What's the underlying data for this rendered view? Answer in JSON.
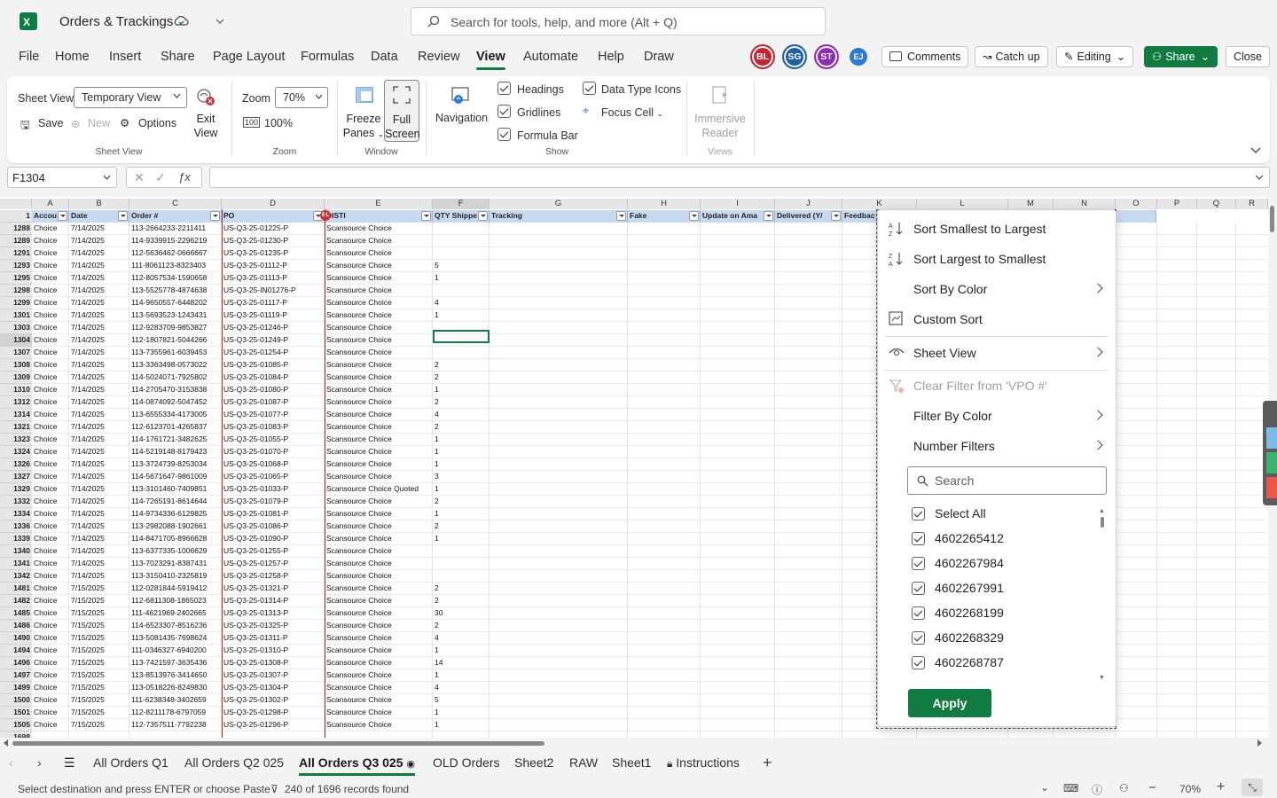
{
  "titlebar": {
    "app_icon": "excel-icon",
    "doc_title": "Orders & Trackings",
    "search_placeholder": "Search for tools, help, and more (Alt + Q)"
  },
  "menu": [
    "File",
    "Home",
    "Insert",
    "Share",
    "Page Layout",
    "Formulas",
    "Data",
    "Review",
    "View",
    "Automate",
    "Help",
    "Draw"
  ],
  "menu_active": "View",
  "collaborators": [
    {
      "initials": "BL",
      "color": "#c4262e"
    },
    {
      "initials": "SG",
      "color": "#1f5fa8"
    },
    {
      "initials": "ST",
      "color": "#8e2db4"
    },
    {
      "initials": "EJ",
      "color": "#2b7cd3"
    }
  ],
  "top_buttons": {
    "comments": "Comments",
    "catchup": "Catch up",
    "editing": "Editing",
    "share": "Share",
    "close": "Close"
  },
  "ribbon": {
    "sheet_view_label": "Sheet View",
    "sheet_view_value": "Temporary View",
    "exit_view": [
      "Exit",
      "View"
    ],
    "save": "Save",
    "new": "New",
    "options": "Options",
    "group_sheet_view": "Sheet View",
    "zoom_label": "Zoom",
    "zoom_value": "70%",
    "zoom_100": "100%",
    "group_zoom": "Zoom",
    "freeze": [
      "Freeze",
      "Panes"
    ],
    "full_screen": [
      "Full",
      "Screen"
    ],
    "group_window": "Window",
    "navigation": "Navigation",
    "headings": "Headings",
    "gridlines": "Gridlines",
    "formula_bar": "Formula Bar",
    "data_type_icons": "Data Type Icons",
    "focus_cell": "Focus Cell",
    "group_show": "Show",
    "immersive_reader": [
      "Immersive",
      "Reader"
    ],
    "group_views": "Views"
  },
  "formula_bar": {
    "name_box": "F1304",
    "content": ""
  },
  "grid": {
    "corner_row": "1",
    "column_letters": [
      "A",
      "B",
      "C",
      "D",
      "E",
      "F",
      "G",
      "H",
      "I",
      "J",
      "K",
      "L",
      "M",
      "N",
      "O",
      "P",
      "Q",
      "R"
    ],
    "headers": [
      "Accou",
      "Date",
      "Order #",
      "PO",
      "DISTI",
      "QTY Shippe",
      "Tracking",
      "Fake",
      "Update on Ama",
      "Delivered (Y/",
      "Feedbac"
    ],
    "rows": [
      [
        "1288",
        "Choice",
        "7/14/2025",
        "113-2664233-2211411",
        "US-Q3-25-01225-P",
        "Scansource Choice",
        ""
      ],
      [
        "1289",
        "Choice",
        "7/14/2025",
        "114-9339915-2296219",
        "US-Q3-25-01230-P",
        "Scansource Choice",
        ""
      ],
      [
        "1291",
        "Choice",
        "7/14/2025",
        "112-5636462-0666667",
        "US-Q3-25-01235-P",
        "Scansource Choice",
        ""
      ],
      [
        "1293",
        "Choice",
        "7/14/2025",
        "111-8061123-8323403",
        "US-Q3-25-01112-P",
        "Scansource Choice",
        "5"
      ],
      [
        "1295",
        "Choice",
        "7/14/2025",
        "112-8057534-1590658",
        "US-Q3-25-01113-P",
        "Scansource Choice",
        "1"
      ],
      [
        "1298",
        "Choice",
        "7/14/2025",
        "113-5525778-4874638",
        "US-Q3-25-IN01276-P",
        "Scansource Choice",
        ""
      ],
      [
        "1299",
        "Choice",
        "7/14/2025",
        "114-9650557-6448202",
        "US-Q3-25-01117-P",
        "Scansource Choice",
        "4"
      ],
      [
        "1301",
        "Choice",
        "7/14/2025",
        "113-5693523-1243431",
        "US-Q3-25-01119-P",
        "Scansource Choice",
        "1"
      ],
      [
        "1303",
        "Choice",
        "7/14/2025",
        "112-9283709-9853827",
        "US-Q3-25-01246-P",
        "Scansource Choice",
        ""
      ],
      [
        "1304",
        "Choice",
        "7/14/2025",
        "112-1807821-5044266",
        "US-Q3-25-01249-P",
        "Scansource Choice",
        ""
      ],
      [
        "1307",
        "Choice",
        "7/14/2025",
        "113-7355961-6039453",
        "US-Q3-25-01254-P",
        "Scansource Choice",
        ""
      ],
      [
        "1308",
        "Choice",
        "7/14/2025",
        "113-3363498-0573022",
        "US-Q3-25-01085-P",
        "Scansource Choice",
        "2"
      ],
      [
        "1309",
        "Choice",
        "7/14/2025",
        "114-5024071-7925802",
        "US-Q3-25-01084-P",
        "Scansource Choice",
        "2"
      ],
      [
        "1310",
        "Choice",
        "7/14/2025",
        "114-2705470-3153838",
        "US-Q3-25-01080-P",
        "Scansource Choice",
        "1"
      ],
      [
        "1312",
        "Choice",
        "7/14/2025",
        "114-0874092-5047452",
        "US-Q3-25-01087-P",
        "Scansource Choice",
        "2"
      ],
      [
        "1314",
        "Choice",
        "7/14/2025",
        "113-6555334-4173005",
        "US-Q3-25-01077-P",
        "Scansource Choice",
        "4"
      ],
      [
        "1321",
        "Choice",
        "7/14/2025",
        "112-6123701-4265837",
        "US-Q3-25-01083-P",
        "Scansource Choice",
        "2"
      ],
      [
        "1323",
        "Choice",
        "7/14/2025",
        "114-1761721-3482625",
        "US-Q3-25-01055-P",
        "Scansource Choice",
        "1"
      ],
      [
        "1324",
        "Choice",
        "7/14/2025",
        "114-5219148-8179423",
        "US-Q3-25-01070-P",
        "Scansource Choice",
        "1"
      ],
      [
        "1326",
        "Choice",
        "7/14/2025",
        "113-3724739-8253034",
        "US-Q3-25-01068-P",
        "Scansource Choice",
        "1"
      ],
      [
        "1327",
        "Choice",
        "7/14/2025",
        "114-5671647-9861009",
        "US-Q3-25-01065-P",
        "Scansource Choice",
        "3"
      ],
      [
        "1329",
        "Choice",
        "7/14/2025",
        "113-3101460-7409851",
        "US-Q3-25-01033-P",
        "Scansource Choice Quoted",
        "1"
      ],
      [
        "1332",
        "Choice",
        "7/14/2025",
        "114-7265191-8614644",
        "US-Q3-25-01079-P",
        "Scansource Choice",
        "2"
      ],
      [
        "1334",
        "Choice",
        "7/14/2025",
        "114-9734336-6129825",
        "US-Q3-25-01081-P",
        "Scansource Choice",
        "1"
      ],
      [
        "1336",
        "Choice",
        "7/14/2025",
        "113-2982088-1902661",
        "US-Q3-25-01086-P",
        "Scansource Choice",
        "2"
      ],
      [
        "1339",
        "Choice",
        "7/14/2025",
        "114-8471705-8966628",
        "US-Q3-25-01090-P",
        "Scansource Choice",
        "1"
      ],
      [
        "1340",
        "Choice",
        "7/14/2025",
        "113-6377335-1006629",
        "US-Q3-25-01255-P",
        "Scansource Choice",
        ""
      ],
      [
        "1341",
        "Choice",
        "7/14/2025",
        "113-7023291-8387431",
        "US-Q3-25-01257-P",
        "Scansource Choice",
        ""
      ],
      [
        "1342",
        "Choice",
        "7/14/2025",
        "113-3150410-2325819",
        "US-Q3-25-01258-P",
        "Scansource Choice",
        ""
      ],
      [
        "1481",
        "Choice",
        "7/15/2025",
        "112-0281844-5919412",
        "US-Q3-25-01321-P",
        "Scansource Choice",
        "2"
      ],
      [
        "1482",
        "Choice",
        "7/15/2025",
        "112-6811308-1865023",
        "US-Q3-25-01314-P",
        "Scansource Choice",
        "2"
      ],
      [
        "1485",
        "Choice",
        "7/15/2025",
        "111-4621969-2402665",
        "US-Q3-25-01313-P",
        "Scansource Choice",
        "30"
      ],
      [
        "1486",
        "Choice",
        "7/15/2025",
        "114-6523307-8516236",
        "US-Q3-25-01325-P",
        "Scansource Choice",
        "2"
      ],
      [
        "1490",
        "Choice",
        "7/15/2025",
        "113-5081435-7698624",
        "US-Q3-25-01311-P",
        "Scansource Choice",
        "4"
      ],
      [
        "1494",
        "Choice",
        "7/15/2025",
        "111-0346327-6940200",
        "US-Q3-25-01310-P",
        "Scansource Choice",
        "1"
      ],
      [
        "1496",
        "Choice",
        "7/15/2025",
        "113-7421597-3635436",
        "US-Q3-25-01308-P",
        "Scansource Choice",
        "14"
      ],
      [
        "1497",
        "Choice",
        "7/15/2025",
        "113-8513976-3414650",
        "US-Q3-25-01307-P",
        "Scansource Choice",
        "1"
      ],
      [
        "1499",
        "Choice",
        "7/15/2025",
        "113-0518226-8249830",
        "US-Q3-25-01304-P",
        "Scansource Choice",
        "4"
      ],
      [
        "1500",
        "Choice",
        "7/15/2025",
        "111-6238348-3402659",
        "US-Q3-25-01302-P",
        "Scansource Choice",
        "5"
      ],
      [
        "1501",
        "Choice",
        "7/15/2025",
        "112-8211178-6797059",
        "US-Q3-25-01298-P",
        "Scansource Choice",
        "1"
      ],
      [
        "1505",
        "Choice",
        "7/15/2025",
        "112-7357511-7792238",
        "US-Q3-25-01296-P",
        "Scansource Choice",
        "1"
      ],
      [
        "1698",
        "",
        "",
        "",
        "",
        "",
        ""
      ]
    ],
    "filter_badge": "BL"
  },
  "dropdown": {
    "sort_asc": "Sort Smallest to Largest",
    "sort_desc": "Sort Largest to Smallest",
    "sort_color": "Sort By Color",
    "custom_sort": "Custom Sort",
    "sheet_view": "Sheet View",
    "clear_filter": "Clear Filter from 'VPO #'",
    "filter_color": "Filter By Color",
    "number_filters": "Number Filters",
    "search_placeholder": "Search",
    "items": [
      "Select All",
      "4602265412",
      "4602267984",
      "4602267991",
      "4602268199",
      "4602268329",
      "4602268787"
    ],
    "apply": "Apply"
  },
  "tabs": [
    "All Orders Q1",
    "All Orders Q2 025",
    "All Orders Q3 025",
    "OLD Orders",
    "Sheet2",
    "RAW",
    "Sheet1",
    "Instructions"
  ],
  "active_tab": "All Orders Q3 025",
  "status": {
    "message": "Select destination and press ENTER or choose Paste",
    "records": "240 of 1696 records found",
    "zoom": "70%"
  },
  "colors": {
    "accent": "#107c41",
    "header_fill": "#c6d9f1",
    "apply_button": "#107c41"
  }
}
